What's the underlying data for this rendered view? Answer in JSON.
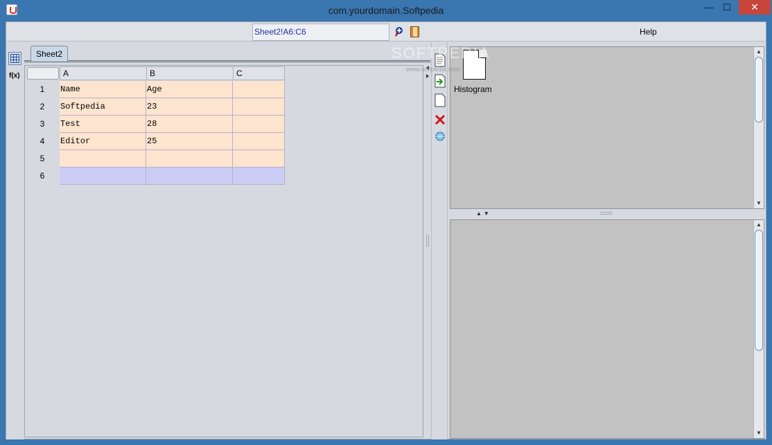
{
  "window": {
    "title": "com.yourdomain.Softpedia",
    "minimize_glyph": "—",
    "maximize_glyph": "☐",
    "close_glyph": "✕"
  },
  "menubar": {
    "cell_reference": "Sheet2!A6:C6",
    "help_label": "Help",
    "toolbar_icons": [
      "ribbon-icon",
      "book-icon"
    ]
  },
  "left_strip": {
    "icons": [
      "spreadsheet-icon"
    ],
    "fx_label": "f(x)"
  },
  "sheet": {
    "tab_label": "Sheet2",
    "columns": [
      "A",
      "B",
      "C"
    ],
    "rows": [
      {
        "num": "1",
        "cells": [
          "Name",
          "Age",
          ""
        ]
      },
      {
        "num": "2",
        "cells": [
          "Softpedia",
          "23",
          ""
        ]
      },
      {
        "num": "3",
        "cells": [
          "Test",
          "28",
          ""
        ]
      },
      {
        "num": "4",
        "cells": [
          "Editor",
          "25",
          ""
        ]
      },
      {
        "num": "5",
        "cells": [
          "",
          "",
          ""
        ]
      },
      {
        "num": "6",
        "cells": [
          "",
          "",
          ""
        ]
      }
    ],
    "selected_row": "6"
  },
  "toolcol": {
    "icons": [
      "document-list-icon",
      "export-arrow-icon",
      "blank-page-icon",
      "delete-icon",
      "globe-icon"
    ]
  },
  "right_panel": {
    "item_label": "Histogram",
    "item_icon": "document-icon"
  },
  "watermark": {
    "text": "SOFTPEDIA",
    "sub": "www.softpedia.com"
  },
  "colors": {
    "titlebar": "#3a76b0",
    "close_button": "#c7463c",
    "cell_fill": "#fde4cf",
    "selected_fill": "#cccdf7",
    "panel_gray": "#c2c2c2"
  }
}
